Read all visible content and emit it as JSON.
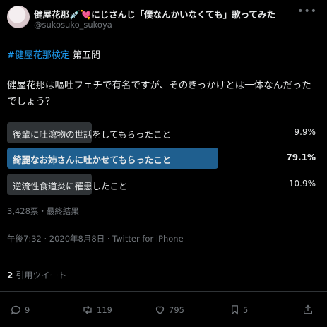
{
  "author": {
    "display_name": "健屋花那💉💘にじさんじ「僕なんかいなくても」歌ってみた",
    "handle": "@sukosuko_sukoya"
  },
  "tweet": {
    "hashtag": "#健屋花那検定",
    "hashtag_suffix": " 第五問",
    "question": "健屋花那は嘔吐フェチで有名ですが、そのきっかけとは一体なんだったでしょう？"
  },
  "poll": {
    "options": [
      {
        "label": "後輩に吐瀉物の世話をしてもらったこと",
        "percent_text": "9.9%",
        "percent": 9.9,
        "winner": false
      },
      {
        "label": "綺麗なお姉さんに吐かせてもらったこと",
        "percent_text": "79.1%",
        "percent": 79.1,
        "winner": true
      },
      {
        "label": "逆流性食道炎に罹患したこと",
        "percent_text": "10.9%",
        "percent": 10.9,
        "winner": false
      }
    ],
    "summary": "3,428票・最終結果"
  },
  "meta": {
    "timestamp": "午後7:32 · 2020年8月8日 · Twitter for iPhone"
  },
  "quotes": {
    "count": "2",
    "label": "引用ツイート"
  },
  "actions": {
    "reply_count": "9",
    "retweet_count": "119",
    "like_count": "795",
    "bookmark_count": "5"
  },
  "colors": {
    "background": "#000000",
    "accent": "#1d9bf0",
    "winner_bar": "#1f5f8f",
    "bar": "#2f3336",
    "muted_text": "#71767b"
  }
}
